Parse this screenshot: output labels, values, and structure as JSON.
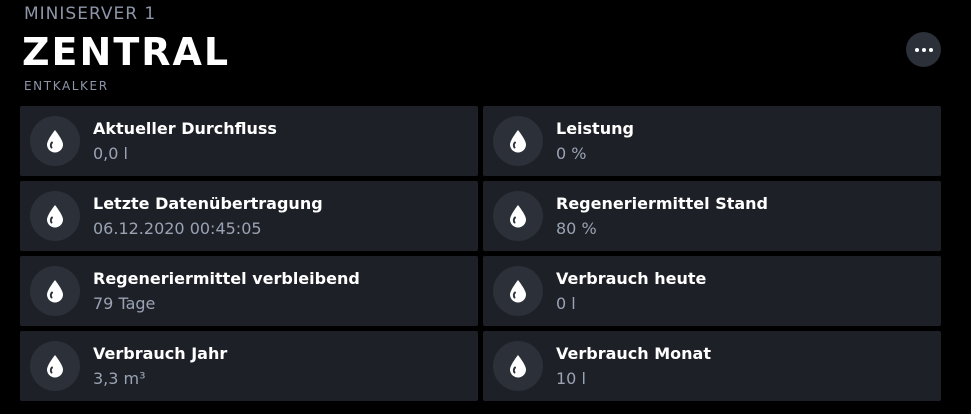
{
  "header": {
    "server": "MINISERVER 1",
    "title": "ZENTRAL",
    "subtitle": "ENTKALKER"
  },
  "menu": {
    "icon": "more-horizontal-icon"
  },
  "tiles": [
    {
      "label": "Aktueller Durchfluss",
      "value": "0,0 l",
      "icon": "water-drop-icon"
    },
    {
      "label": "Leistung",
      "value": "0 %",
      "icon": "water-drop-icon"
    },
    {
      "label": "Letzte Datenübertragung",
      "value": "06.12.2020 00:45:05",
      "icon": "water-drop-icon"
    },
    {
      "label": "Regeneriermittel Stand",
      "value": "80 %",
      "icon": "water-drop-icon"
    },
    {
      "label": "Regeneriermittel verbleibend",
      "value": "79 Tage",
      "icon": "water-drop-icon"
    },
    {
      "label": "Verbrauch heute",
      "value": "0 l",
      "icon": "water-drop-icon"
    },
    {
      "label": "Verbrauch Jahr",
      "value": "3,3 m³",
      "icon": "water-drop-icon"
    },
    {
      "label": "Verbrauch Monat",
      "value": "10 l",
      "icon": "water-drop-icon"
    }
  ],
  "colors": {
    "background": "#000000",
    "tile": "#1d2026",
    "icon_circle": "#2b3039",
    "muted_text": "#8d96a8",
    "value_text": "#9aa3b4"
  }
}
